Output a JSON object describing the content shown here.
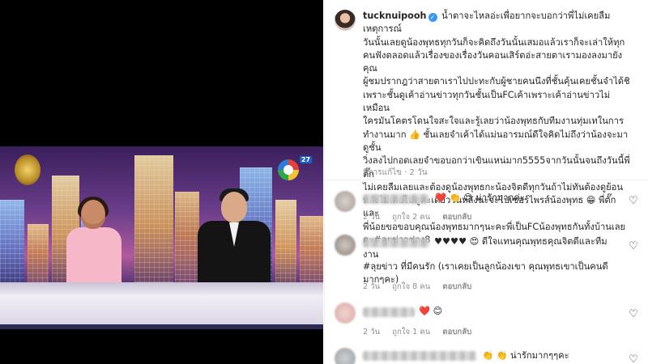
{
  "post": {
    "username": "tucknuipooh",
    "verified_icon": "verified-badge-icon",
    "caption": "น้ำตาจะไหลอ่ะเพื่อยากจะบอกว่าพี่ไม่เคยลืมเหตุการณ์\nวันนั้นเลยดูน้องพุทธทุกวันก็จะคิดถึงวันนั้นเสมอแล้วเราก็จะเล่าให้ทุก\nคนฟังตลอดแล้วเรื่องของเรื่องวันคอนเสิร์ตอ่ะสายตาเรามองลงมายังคุณ\nผู้ชมปรากฎว่าสายตาเราไปปะทะกับผู้ชายคนนึงที่ชั้นคุ้นเคยชั้นจำได้ชิ\nเพราะชั้นดูเค้าอ่านข่าวทุกวันชั้นเป็นFCเค้าเพราะเค้าอ่านข่าวไม่เหมือน\nใครมันโคตรโดนใจสะใจและรู้เลยว่าน้องพุทธกับทีมงานทุ่มเทในการ\nทำงานมาก 👍 ชั้นเลยจำเค้าได้แม่นอารมณ์ดีใจคิดไม่ถึงว่าน้องจะมาดูชั้น\nวิ่งลงไปกอดเลยจำขอบอกว่าเขินแหน่มาก5555จากวันนั้นจนถึงวันนี้พี่ตั๊ก\nไม่เคยลืมเลยและต้องดูน้องพุทธกะน้องจิตดีทุกวันถ้าไม่ทันต้องดูย้อน\nหลังไม่เคยไม่ดูคะเดี๋ยววันหลังนะจะไปเซอร์ไพรส์น้องพุทธ 😁 พี่ตั๊กและ\nพี่น้อยขอขอบคุณน้องพุทธมากๆนะคะพี่เป็นFCน้องพุทธกันทั้งบ้านเลย\nคะ#ลุยข่าวช่อง8",
    "meta": "มีการแก้ไข · 2 วัน"
  },
  "comments": [
    {
      "text": "❤️ 👏 😍 น่ารักมากค่ะ",
      "time": "2 วัน",
      "likes": "ถูกใจ 2 คน",
      "reply": "ตอบกลับ"
    },
    {
      "text": "♥♥♥♥ 😍 ดีใจแทนคุณพุทธคุณจิตดีและทีมงาน\n#ลุยข่าว ที่มีคนรัก (เราเคยเป็นลูกน้องเขา คุณพุทธเขาเป็นคนดี\nมากๆคะ)",
      "time": "2 วัน",
      "likes": "ถูกใจ 8 คน",
      "reply": "ตอบกลับ"
    },
    {
      "text": "❤️ 😊",
      "time": "2 วัน",
      "likes": "ถูกใจ 1 คน",
      "reply": "ตอบกลับ"
    },
    {
      "text": "👏 👏 น่ารักมากๆๆคะ",
      "time": "",
      "likes": "",
      "reply": ""
    }
  ],
  "video": {
    "channel_number": "27",
    "left_logo_icon": "royal-emblem-icon",
    "channel_logo_icon": "channel-8-logo-icon"
  },
  "icons": {
    "like": "heart-outline-icon"
  }
}
